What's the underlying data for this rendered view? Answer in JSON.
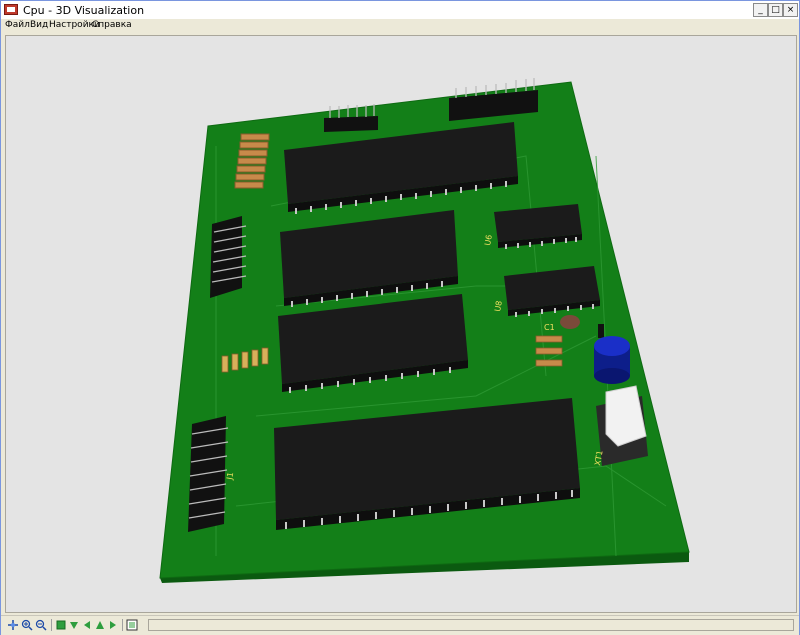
{
  "window": {
    "title": "Cpu - 3D Visualization",
    "controls": {
      "minimize": "_",
      "maximize": "□",
      "close": "×"
    }
  },
  "menu": [
    {
      "label": "Файл"
    },
    {
      "label": "Вид"
    },
    {
      "label": "Настройки"
    },
    {
      "label": "Справка"
    }
  ],
  "toolbar": {
    "buttons": [
      "pan-icon",
      "zoom-in-icon",
      "zoom-out-icon",
      "view-top-icon",
      "view-bottom-icon",
      "view-left-icon",
      "view-front-icon",
      "view-right-icon",
      "layers-icon"
    ]
  },
  "board": {
    "colors": {
      "pcb": "#137f18",
      "pcb_edge": "#0b5a10",
      "chip": "#1b1b1b",
      "pin": "#c8c8c8",
      "resistor": "#c78a4a",
      "capacitor": "#1a2fc8",
      "crystal": "#f2f2f2"
    },
    "labels": {
      "c1": "C1",
      "xt1": "XT1",
      "j1": "J1",
      "u6": "U6",
      "u8": "U8"
    }
  }
}
